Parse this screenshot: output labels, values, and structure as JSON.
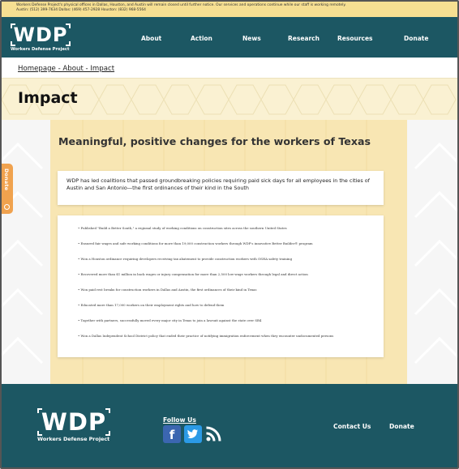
{
  "notice": {
    "line1": "Workers Defense Project's physical offices in Dallas, Houston, and Austin will remain closed until further notice. Our services and operations continue while our staff is working remotely.",
    "line2": "Austin: (512) 399-7634 Dallas: (469) 457-2928 Houston: (832) 968-5564"
  },
  "header": {
    "logo_text": "WDP",
    "logo_subtitle": "Workers Defense Project",
    "nav": [
      "About",
      "Action",
      "News",
      "Research",
      "Resources",
      "Donate"
    ]
  },
  "breadcrumb": "Homepage - About - Impact",
  "page_title": "Impact",
  "side_tab": {
    "label": "Donate",
    "icon": "circle-icon",
    "color": "#f0a24e"
  },
  "main": {
    "heading": "Meaningful, positive changes for the workers of Texas",
    "summary": "WDP has led coalitions that passed groundbreaking policies requiring paid sick days for all employees in the cities of Austin and San Antonio—the first ordinances of their kind in the South",
    "items": [
      "Published \"Build a Better South,\" a regional study of working conditions on construction sites across the southern United States",
      "Ensured fair wages and safe working conditions for more than 19,000 construction workers through WDP's innovative Better Builder® program",
      "Won a Houston ordinance requiring developers receiving tax abatement to provide construction workers with OSHA safety training",
      "Recovered more than $1 million in back wages or injury compensation for more than 2,500 low-wage workers through legal and direct action",
      "Won paid rest breaks for construction workers in Dallas and Austin, the first ordinances of their kind in Texas",
      "Educated more than 17,000 workers on their employment rights and how to defend them",
      "Together with partners, successfully moved every major city in Texas to join a lawsuit against the state over SB4",
      "Won a Dallas Independent School District policy that ended their practice of notifying immigration enforcement when they encounter undocumented persons"
    ]
  },
  "footer": {
    "logo_text": "WDP",
    "logo_subtitle": "Workers Defense Project",
    "follow_us": "Follow Us",
    "social": [
      "facebook-icon",
      "twitter-icon",
      "rss-icon"
    ],
    "links": [
      "Contact Us",
      "Donate"
    ]
  },
  "colors": {
    "teal": "#1c5763",
    "notice_yellow": "#f6df92",
    "panel_yellow": "#f8e6b3",
    "orange": "#f0a24e",
    "facebook_blue": "#3b66b0",
    "twitter_blue": "#2b9ae6"
  }
}
